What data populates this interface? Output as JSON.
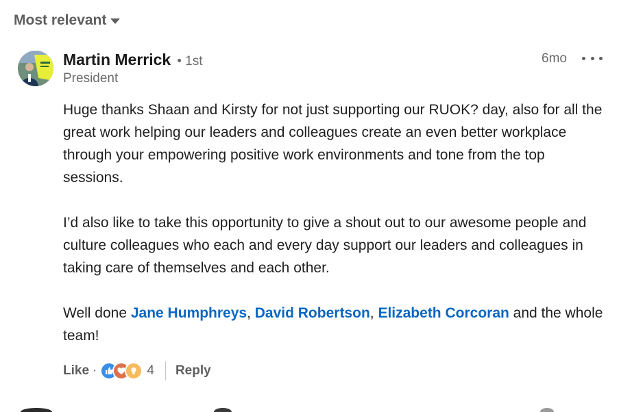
{
  "sort": {
    "label": "Most relevant",
    "icon": "caret-down-icon"
  },
  "comment": {
    "author": {
      "name": "Martin Merrick",
      "degree": "• 1st",
      "title": "President"
    },
    "timestamp": "6mo",
    "more_icon": "ellipsis-icon",
    "paragraphs": [
      {
        "text": "Huge thanks Shaan and Kirsty for not just supporting our RUOK? day, also for all the great work helping our leaders and colleagues create an even better workplace through your empowering positive work environments and tone from the top sessions."
      },
      {
        "text": "I’d also like to take this opportunity to give a shout out to our awesome people and culture colleagues who each and every day support our leaders and colleagues in taking care of themselves and each other."
      }
    ],
    "closing": {
      "prefix": "Well done ",
      "mentions": [
        "Jane Humphreys",
        "David Robertson",
        "Elizabeth Corcoran"
      ],
      "sep1": ", ",
      "sep2": ", ",
      "suffix": " and the whole team!"
    },
    "actions": {
      "like": "Like",
      "dot": "·",
      "reaction_icons": [
        "like-reaction-icon",
        "love-reaction-icon",
        "insightful-reaction-icon"
      ],
      "reaction_count": "4",
      "reply": "Reply"
    }
  },
  "colors": {
    "mention": "#0a66c2",
    "secondary_text": "#6b6b6b",
    "like_reaction": "#378fe9",
    "love_reaction": "#df704d",
    "insightful_reaction": "#f5bb5c"
  }
}
